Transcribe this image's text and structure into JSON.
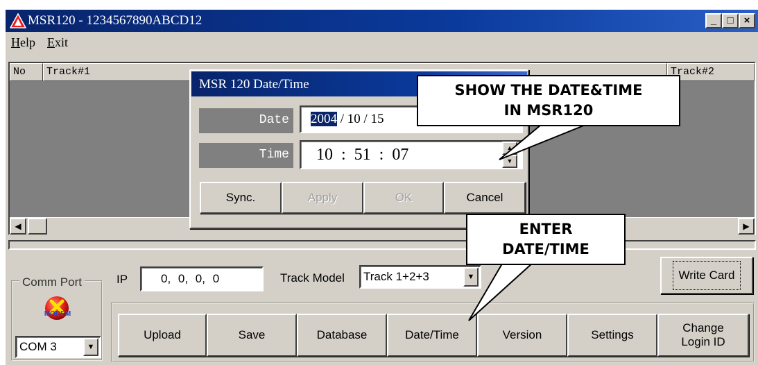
{
  "window": {
    "title": "MSR120 - 1234567890ABCD12",
    "controls": {
      "minimize": "_",
      "maximize": "□",
      "close": "×"
    }
  },
  "menu": {
    "items": [
      "Help",
      "Exit"
    ]
  },
  "list": {
    "columns": [
      "No",
      "Track#1",
      "Track#2"
    ]
  },
  "comm": {
    "group_label": "Comm Port",
    "modem_label": "MODEM",
    "port_value": "COM 3"
  },
  "ip": {
    "label": "IP",
    "value": "0,  0,  0,  0"
  },
  "track_model": {
    "label": "Track Model",
    "value": "Track 1+2+3"
  },
  "write_card": {
    "label": "Write Card"
  },
  "toolbar": {
    "buttons": [
      "Upload",
      "Save",
      "Database",
      "Date/Time",
      "Version",
      "Settings",
      "Change Login ID"
    ]
  },
  "dialog": {
    "title": "MSR 120 Date/Time",
    "date_label": "Date",
    "date_year": "2004",
    "date_rest": "/ 10 / 15",
    "time_label": "Time",
    "time_value": "10  :  51  :  07",
    "buttons": {
      "sync": "Sync.",
      "apply": "Apply",
      "ok": "OK",
      "cancel": "Cancel"
    }
  },
  "callouts": {
    "top": {
      "line1": "SHOW THE DATE&TIME",
      "line2": "IN MSR120"
    },
    "bottom": {
      "line1": "ENTER",
      "line2": "DATE/TIME"
    }
  },
  "colors": {
    "titlebar": "#0a3a9c",
    "face": "#d4d0c8",
    "list_bg": "#808080",
    "modem_icon": "#e8201c"
  }
}
